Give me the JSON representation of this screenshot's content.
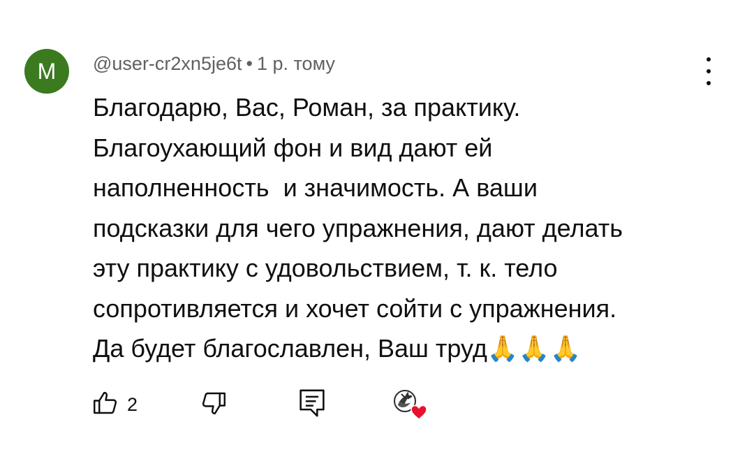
{
  "comment": {
    "avatar_letter": "M",
    "avatar_color": "#3b7a1f",
    "username": "@user-cr2xn5je6t",
    "separator": "•",
    "timestamp": "1 р. тому",
    "lines": [
      "Благодарю, Вас, Роман, за практику.",
      "Благоухающий фон и вид дают ей",
      "наполненность  и значимость. А ваши",
      "подсказки для чего упражнения, дают делать",
      "эту практику с удовольствием, т. к. тело",
      "сопротивляется и хочет сойти с упражнения.",
      "Да будет благославлен, Ваш труд🙏🙏🙏"
    ],
    "like_count": "2"
  },
  "icons": {
    "more": "more-vert-icon",
    "like": "thumb-up-icon",
    "dislike": "thumb-down-icon",
    "reply": "reply-comment-icon",
    "creator_heart": "creator-heart-icon"
  },
  "colors": {
    "text": "#0f0f0f",
    "secondary_text": "#606060",
    "heart": "#e8112d"
  }
}
